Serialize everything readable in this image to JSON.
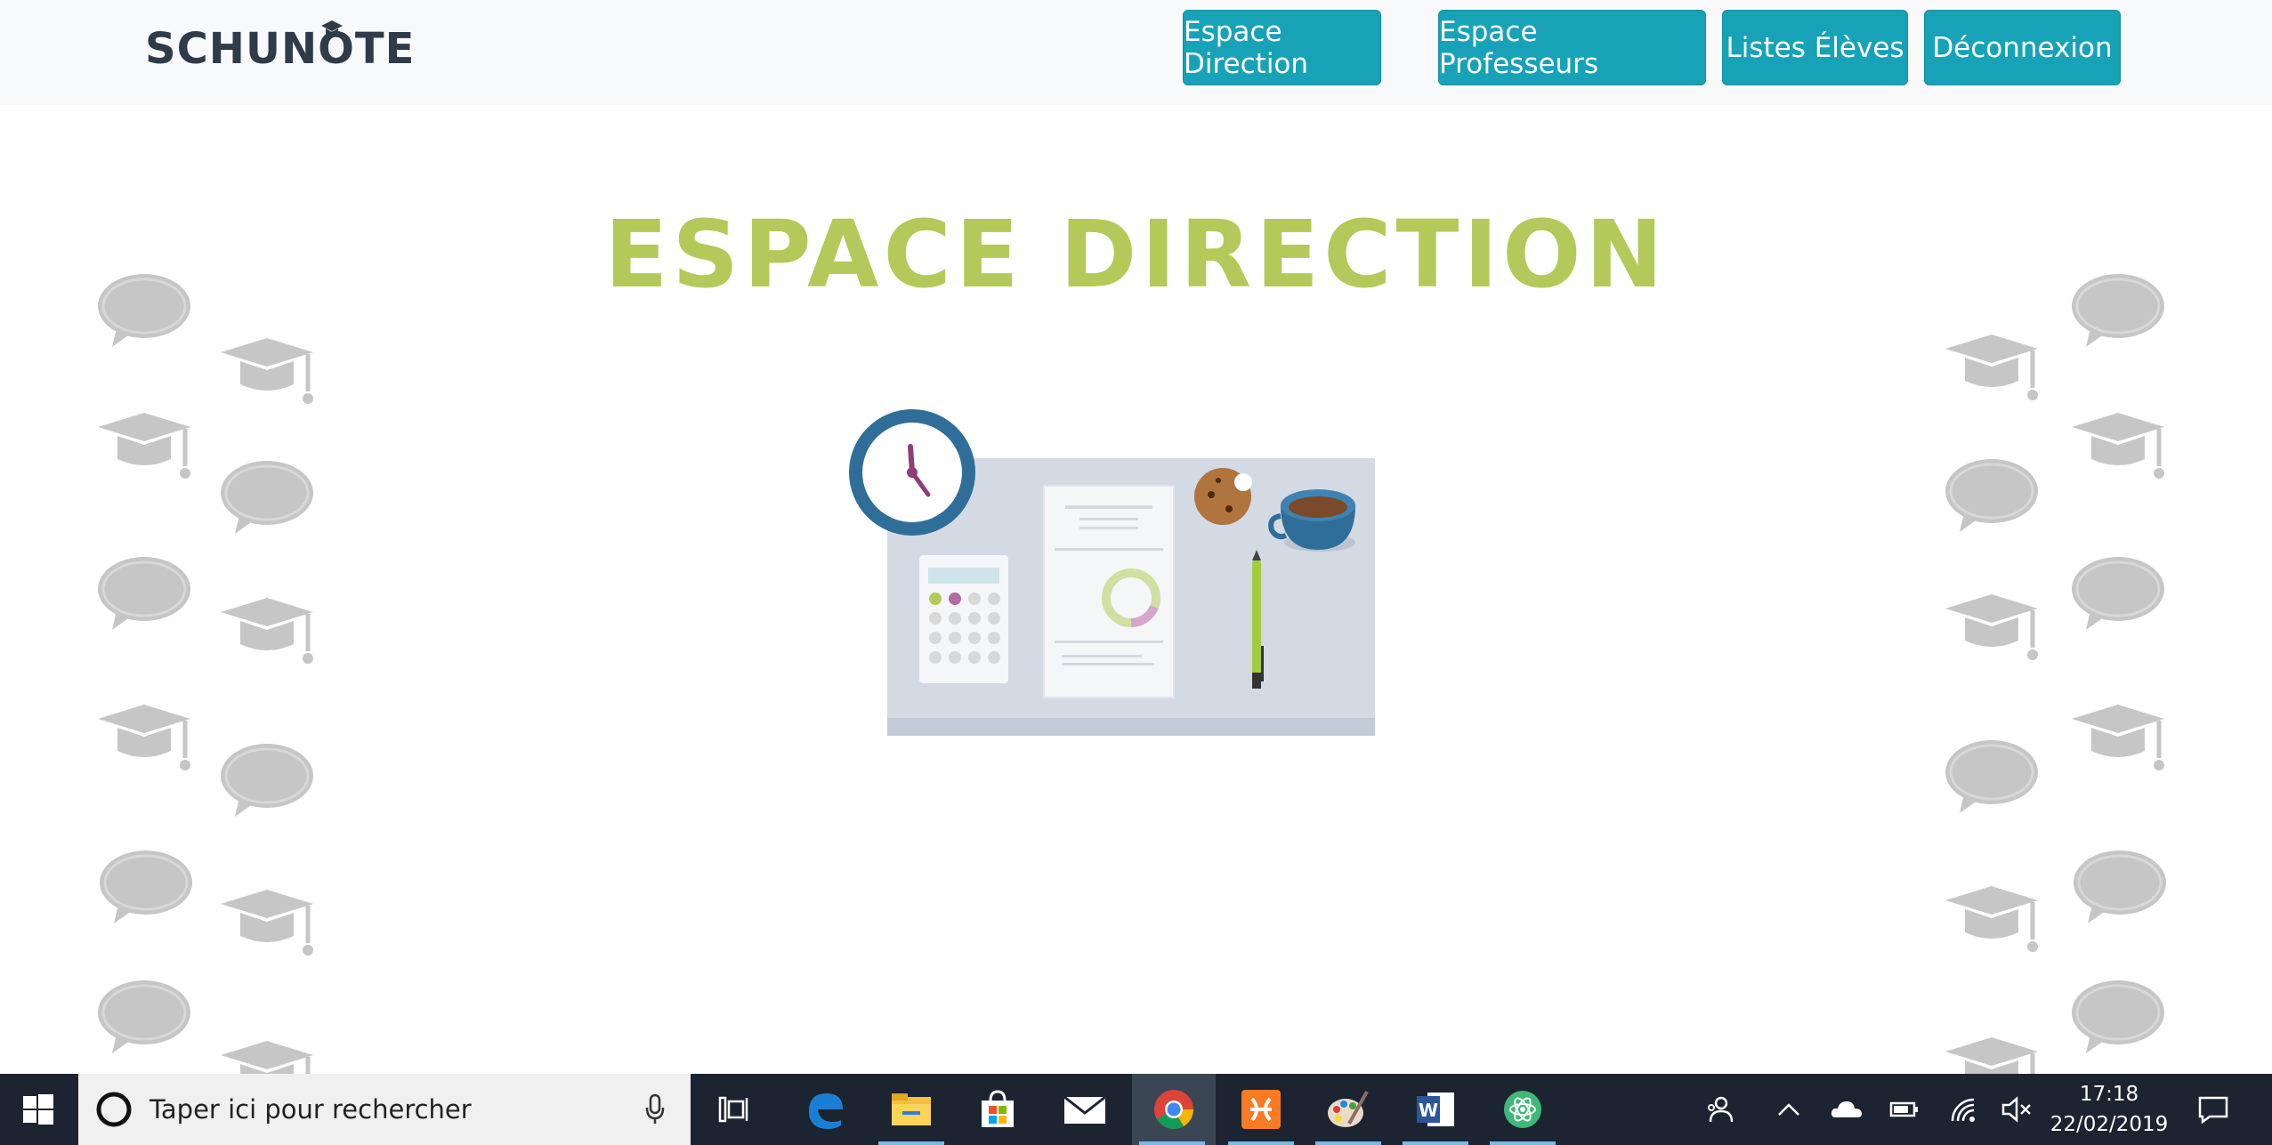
{
  "navbar": {
    "logo": "SCHUNOTE",
    "buttons": [
      {
        "label": "Espace Direction"
      },
      {
        "label": "Espace Professeurs"
      },
      {
        "label": "Listes Élèves"
      },
      {
        "label": "Déconnexion"
      }
    ]
  },
  "main": {
    "title": "ESPACE DIRECTION",
    "illustration_icon": "desk-workspace-illustration"
  },
  "colors": {
    "nav_button": "#17a2b8",
    "title": "#b5c95a",
    "logo": "#2e3b4a",
    "decoration": "#c6c6c6",
    "taskbar": "#1b2430"
  },
  "taskbar": {
    "search_placeholder": "Taper ici pour rechercher",
    "apps": [
      "task-view-icon",
      "edge-icon",
      "file-explorer-icon",
      "store-icon",
      "mail-icon",
      "chrome-icon",
      "xampp-icon",
      "paint-icon",
      "word-icon",
      "atom-icon"
    ],
    "time": "17:18",
    "date": "22/02/2019"
  }
}
